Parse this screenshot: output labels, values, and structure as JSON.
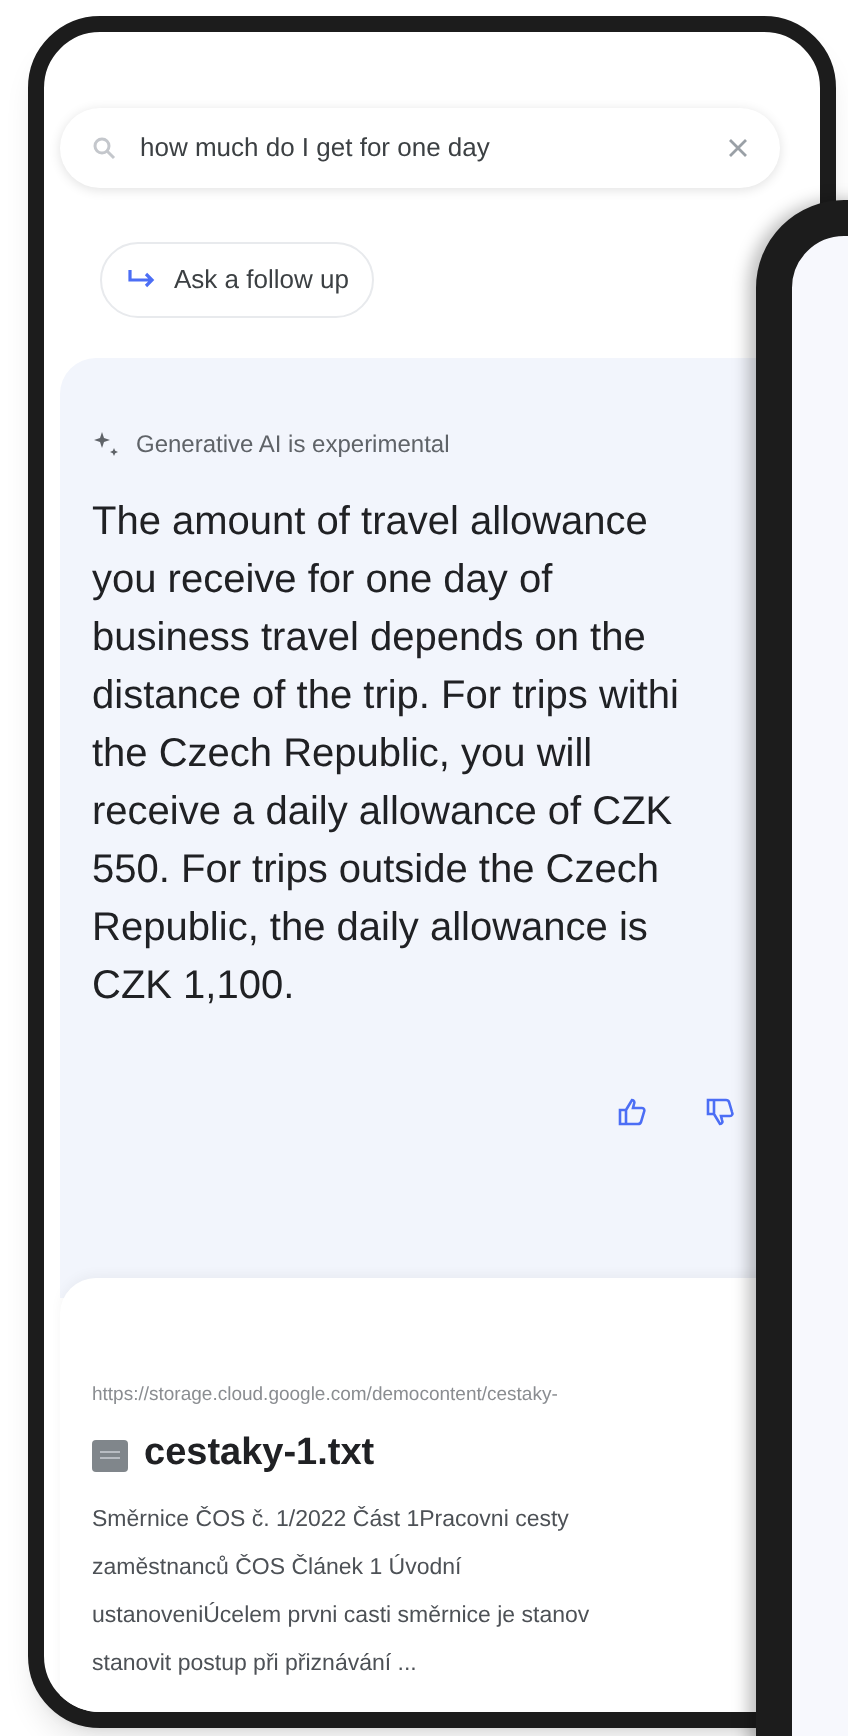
{
  "search": {
    "value": "how much do I get for one day"
  },
  "follow_up_button": {
    "label": "Ask a follow up"
  },
  "ai_answer": {
    "notice": "Generative AI is experimental",
    "lines": [
      "The amount of travel allowance",
      "you receive for one day of",
      "business travel depends on the",
      "distance of the trip. For trips withi",
      "the Czech Republic, you will",
      "receive a daily allowance of CZK",
      "550. For trips outside the Czech",
      "Republic, the daily allowance is",
      "CZK 1,100."
    ]
  },
  "result": {
    "url": "https://storage.cloud.google.com/democontent/cestaky-",
    "title": "cestaky-1.txt",
    "snippet_lines": [
      "Směrnice ČOS č. 1/2022 Část 1Pracovni cesty",
      "zaměstnanců ČOS Článek 1 Úvodní",
      "ustanoveniÚcelem prvni casti směrnice je stanov",
      "stanovit postup při přiznávání ..."
    ]
  }
}
